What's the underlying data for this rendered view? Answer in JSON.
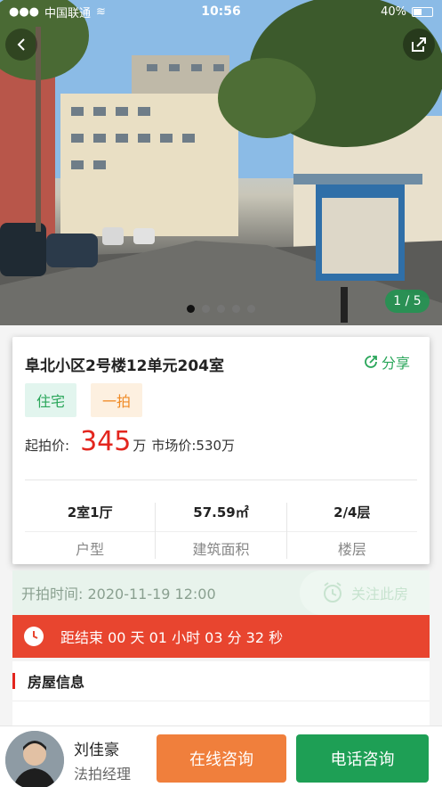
{
  "status_bar": {
    "carrier": "中国联通",
    "time": "10:56",
    "battery": "40%"
  },
  "gallery": {
    "counter": "1 / 5",
    "slide_count": 5,
    "active_index": 0
  },
  "listing": {
    "title": "阜北小区2号楼12单元204室",
    "share_label": "分享",
    "tags": [
      "住宅",
      "一拍"
    ],
    "start_price_label": "起拍价:",
    "start_price_value": "345",
    "start_price_unit": "万",
    "market_price": "市场价:530万",
    "stats": [
      {
        "value": "2室1厅",
        "label": "户型"
      },
      {
        "value": "57.59㎡",
        "label": "建筑面积"
      },
      {
        "value": "2/4层",
        "label": "楼层"
      }
    ]
  },
  "auction": {
    "start_time": "开拍时间:  2020-11-19 12:00",
    "follow_label": "关注此房",
    "countdown": "距结束 00 天 01 小时 03 分 32 秒"
  },
  "section": {
    "title": "房屋信息"
  },
  "agent": {
    "name": "刘佳豪",
    "role": "法拍经理",
    "online_button": "在线咨询",
    "phone_button": "电话咨询"
  },
  "colors": {
    "accent_green": "#2aa65a",
    "price_red": "#e3261e",
    "countdown_red": "#e8452f",
    "online_orange": "#f07f3c",
    "phone_green": "#1e9f55"
  }
}
